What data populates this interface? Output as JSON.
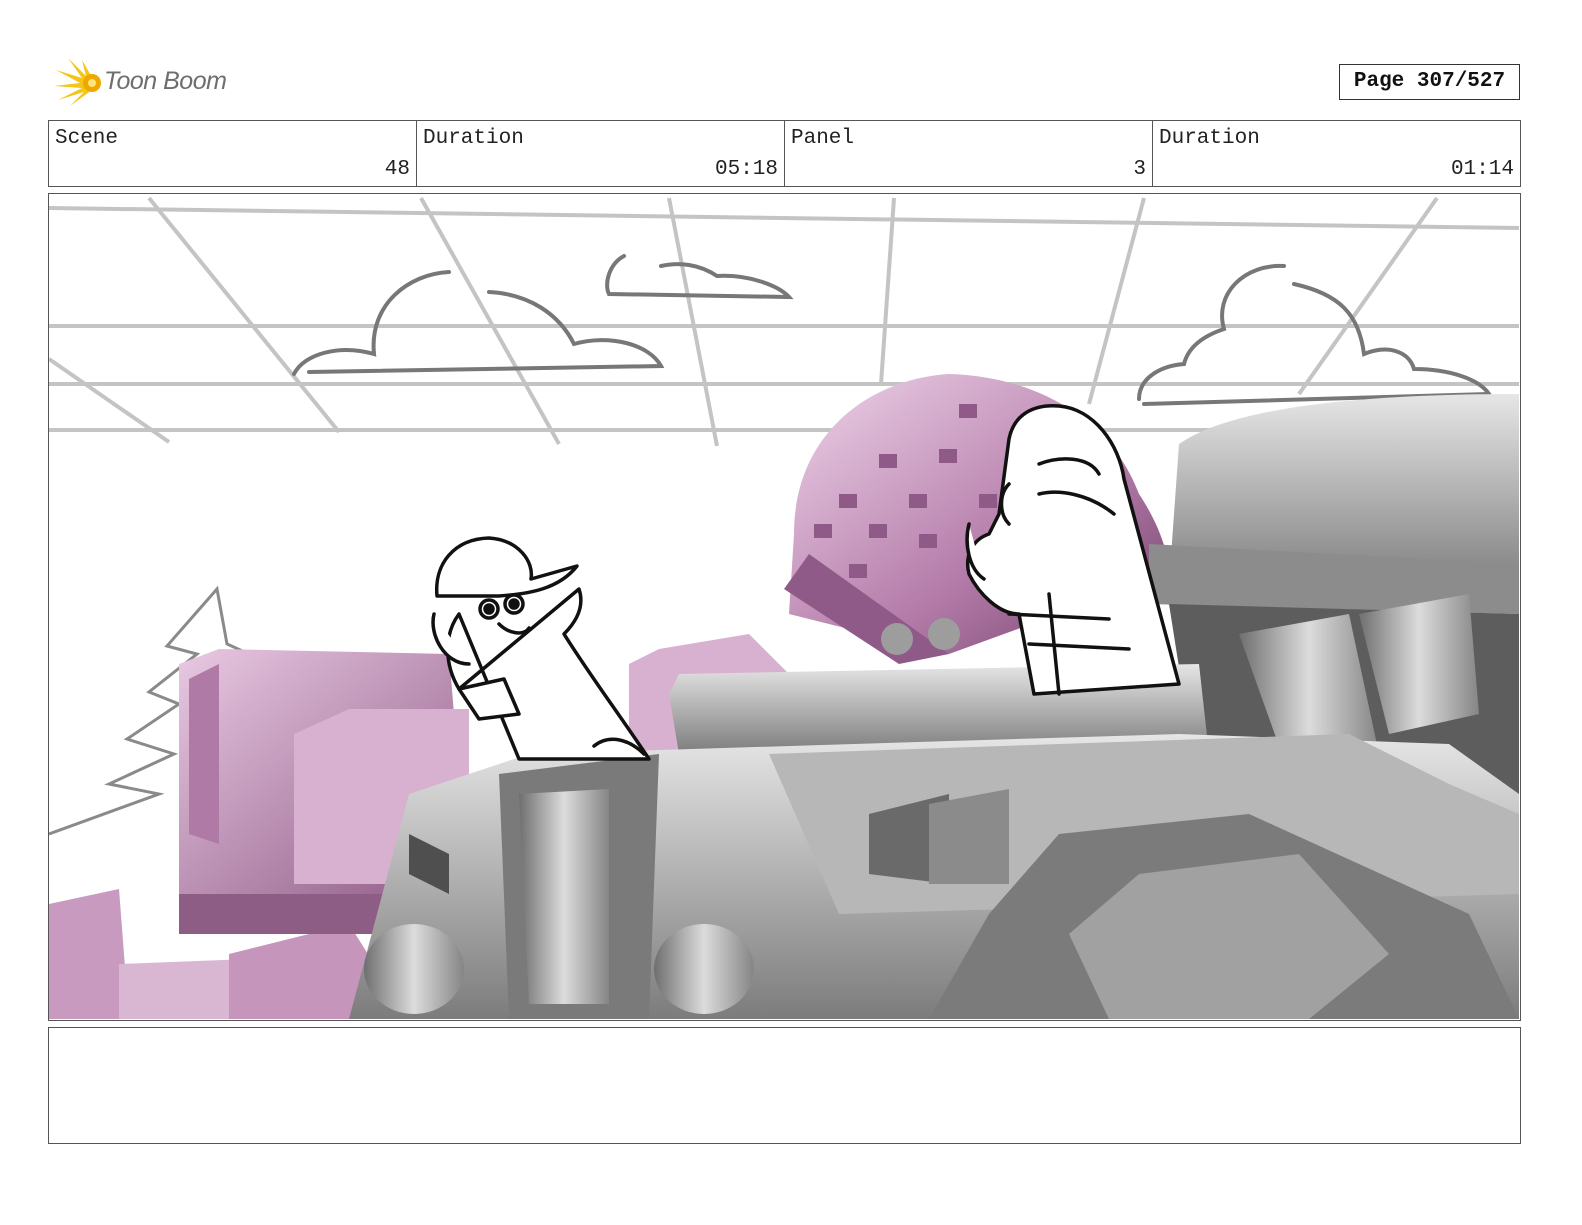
{
  "logo": {
    "text": "Toon Boom"
  },
  "page": {
    "label": "Page 307/527"
  },
  "info": {
    "scene_label": "Scene",
    "scene_value": "48",
    "scene_duration_label": "Duration",
    "scene_duration_value": "05:18",
    "panel_label": "Panel",
    "panel_value": "3",
    "panel_duration_label": "Duration",
    "panel_duration_value": "01:14"
  },
  "notes": {
    "text": ""
  },
  "colors": {
    "machine_grey": "#9a9a9a",
    "machine_pink": "#c99bc0",
    "sketch_line": "#111111",
    "ceiling_line": "#c4c4c4"
  }
}
